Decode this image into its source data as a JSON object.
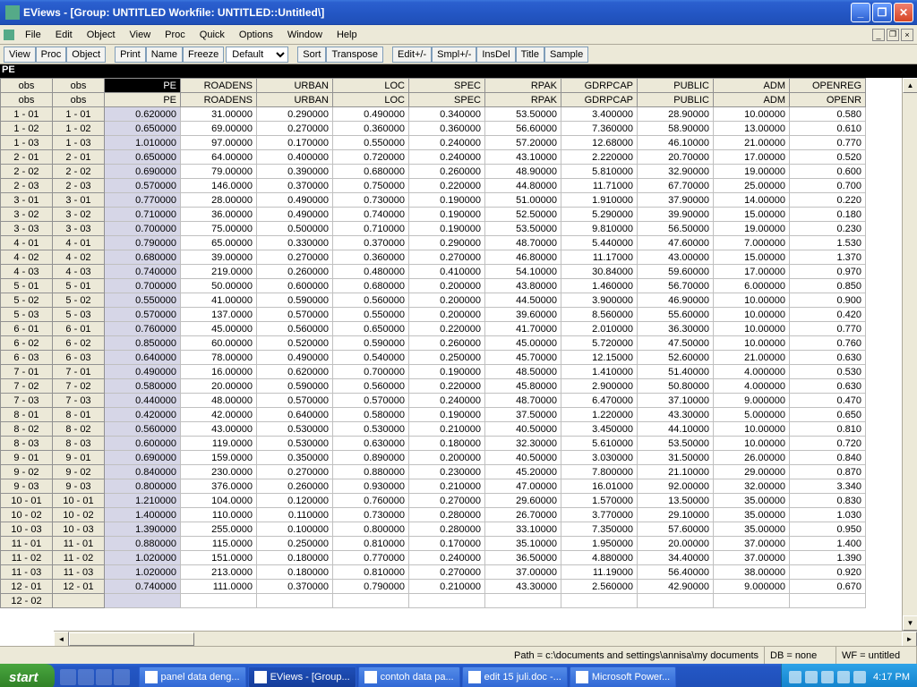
{
  "title": "EViews - [Group: UNTITLED   Workfile: UNTITLED::Untitled\\]",
  "menu": [
    "File",
    "Edit",
    "Object",
    "View",
    "Proc",
    "Quick",
    "Options",
    "Window",
    "Help"
  ],
  "toolbar1": [
    "View",
    "Proc",
    "Object"
  ],
  "toolbar2": [
    "Print",
    "Name",
    "Freeze"
  ],
  "toolbar_sel": "Default",
  "toolbar3": [
    "Sort",
    "Transpose"
  ],
  "toolbar4": [
    "Edit+/-",
    "Smpl+/-",
    "InsDel",
    "Title",
    "Sample"
  ],
  "dark_label": "PE",
  "cols": [
    "obs",
    "obs",
    "PE",
    "ROADENS",
    "URBAN",
    "LOC",
    "SPEC",
    "RPAK",
    "GDRPCAP",
    "PUBLIC",
    "ADM",
    "OPENREG"
  ],
  "cols2_last": "OPENR",
  "rows": [
    {
      "h": "1 - 01",
      "o": "1 - 01",
      "d": [
        "0.620000",
        "31.00000",
        "0.290000",
        "0.490000",
        "0.340000",
        "53.50000",
        "3.400000",
        "28.90000",
        "10.00000",
        "0.580"
      ]
    },
    {
      "h": "1 - 02",
      "o": "1 - 02",
      "d": [
        "0.650000",
        "69.00000",
        "0.270000",
        "0.360000",
        "0.360000",
        "56.60000",
        "7.360000",
        "58.90000",
        "13.00000",
        "0.610"
      ]
    },
    {
      "h": "1 - 03",
      "o": "1 - 03",
      "d": [
        "1.010000",
        "97.00000",
        "0.170000",
        "0.550000",
        "0.240000",
        "57.20000",
        "12.68000",
        "46.10000",
        "21.00000",
        "0.770"
      ]
    },
    {
      "h": "2 - 01",
      "o": "2 - 01",
      "d": [
        "0.650000",
        "64.00000",
        "0.400000",
        "0.720000",
        "0.240000",
        "43.10000",
        "2.220000",
        "20.70000",
        "17.00000",
        "0.520"
      ]
    },
    {
      "h": "2 - 02",
      "o": "2 - 02",
      "d": [
        "0.690000",
        "79.00000",
        "0.390000",
        "0.680000",
        "0.260000",
        "48.90000",
        "5.810000",
        "32.90000",
        "19.00000",
        "0.600"
      ]
    },
    {
      "h": "2 - 03",
      "o": "2 - 03",
      "d": [
        "0.570000",
        "146.0000",
        "0.370000",
        "0.750000",
        "0.220000",
        "44.80000",
        "11.71000",
        "67.70000",
        "25.00000",
        "0.700"
      ]
    },
    {
      "h": "3 - 01",
      "o": "3 - 01",
      "d": [
        "0.770000",
        "28.00000",
        "0.490000",
        "0.730000",
        "0.190000",
        "51.00000",
        "1.910000",
        "37.90000",
        "14.00000",
        "0.220"
      ]
    },
    {
      "h": "3 - 02",
      "o": "3 - 02",
      "d": [
        "0.710000",
        "36.00000",
        "0.490000",
        "0.740000",
        "0.190000",
        "52.50000",
        "5.290000",
        "39.90000",
        "15.00000",
        "0.180"
      ]
    },
    {
      "h": "3 - 03",
      "o": "3 - 03",
      "d": [
        "0.700000",
        "75.00000",
        "0.500000",
        "0.710000",
        "0.190000",
        "53.50000",
        "9.810000",
        "56.50000",
        "19.00000",
        "0.230"
      ]
    },
    {
      "h": "4 - 01",
      "o": "4 - 01",
      "d": [
        "0.790000",
        "65.00000",
        "0.330000",
        "0.370000",
        "0.290000",
        "48.70000",
        "5.440000",
        "47.60000",
        "7.000000",
        "1.530"
      ]
    },
    {
      "h": "4 - 02",
      "o": "4 - 02",
      "d": [
        "0.680000",
        "39.00000",
        "0.270000",
        "0.360000",
        "0.270000",
        "46.80000",
        "11.17000",
        "43.00000",
        "15.00000",
        "1.370"
      ]
    },
    {
      "h": "4 - 03",
      "o": "4 - 03",
      "d": [
        "0.740000",
        "219.0000",
        "0.260000",
        "0.480000",
        "0.410000",
        "54.10000",
        "30.84000",
        "59.60000",
        "17.00000",
        "0.970"
      ]
    },
    {
      "h": "5 - 01",
      "o": "5 - 01",
      "d": [
        "0.700000",
        "50.00000",
        "0.600000",
        "0.680000",
        "0.200000",
        "43.80000",
        "1.460000",
        "56.70000",
        "6.000000",
        "0.850"
      ]
    },
    {
      "h": "5 - 02",
      "o": "5 - 02",
      "d": [
        "0.550000",
        "41.00000",
        "0.590000",
        "0.560000",
        "0.200000",
        "44.50000",
        "3.900000",
        "46.90000",
        "10.00000",
        "0.900"
      ]
    },
    {
      "h": "5 - 03",
      "o": "5 - 03",
      "d": [
        "0.570000",
        "137.0000",
        "0.570000",
        "0.550000",
        "0.200000",
        "39.60000",
        "8.560000",
        "55.60000",
        "10.00000",
        "0.420"
      ]
    },
    {
      "h": "6 - 01",
      "o": "6 - 01",
      "d": [
        "0.760000",
        "45.00000",
        "0.560000",
        "0.650000",
        "0.220000",
        "41.70000",
        "2.010000",
        "36.30000",
        "10.00000",
        "0.770"
      ]
    },
    {
      "h": "6 - 02",
      "o": "6 - 02",
      "d": [
        "0.850000",
        "60.00000",
        "0.520000",
        "0.590000",
        "0.260000",
        "45.00000",
        "5.720000",
        "47.50000",
        "10.00000",
        "0.760"
      ]
    },
    {
      "h": "6 - 03",
      "o": "6 - 03",
      "d": [
        "0.640000",
        "78.00000",
        "0.490000",
        "0.540000",
        "0.250000",
        "45.70000",
        "12.15000",
        "52.60000",
        "21.00000",
        "0.630"
      ]
    },
    {
      "h": "7 - 01",
      "o": "7 - 01",
      "d": [
        "0.490000",
        "16.00000",
        "0.620000",
        "0.700000",
        "0.190000",
        "48.50000",
        "1.410000",
        "51.40000",
        "4.000000",
        "0.530"
      ]
    },
    {
      "h": "7 - 02",
      "o": "7 - 02",
      "d": [
        "0.580000",
        "20.00000",
        "0.590000",
        "0.560000",
        "0.220000",
        "45.80000",
        "2.900000",
        "50.80000",
        "4.000000",
        "0.630"
      ]
    },
    {
      "h": "7 - 03",
      "o": "7 - 03",
      "d": [
        "0.440000",
        "48.00000",
        "0.570000",
        "0.570000",
        "0.240000",
        "48.70000",
        "6.470000",
        "37.10000",
        "9.000000",
        "0.470"
      ]
    },
    {
      "h": "8 - 01",
      "o": "8 - 01",
      "d": [
        "0.420000",
        "42.00000",
        "0.640000",
        "0.580000",
        "0.190000",
        "37.50000",
        "1.220000",
        "43.30000",
        "5.000000",
        "0.650"
      ]
    },
    {
      "h": "8 - 02",
      "o": "8 - 02",
      "d": [
        "0.560000",
        "43.00000",
        "0.530000",
        "0.530000",
        "0.210000",
        "40.50000",
        "3.450000",
        "44.10000",
        "10.00000",
        "0.810"
      ]
    },
    {
      "h": "8 - 03",
      "o": "8 - 03",
      "d": [
        "0.600000",
        "119.0000",
        "0.530000",
        "0.630000",
        "0.180000",
        "32.30000",
        "5.610000",
        "53.50000",
        "10.00000",
        "0.720"
      ]
    },
    {
      "h": "9 - 01",
      "o": "9 - 01",
      "d": [
        "0.690000",
        "159.0000",
        "0.350000",
        "0.890000",
        "0.200000",
        "40.50000",
        "3.030000",
        "31.50000",
        "26.00000",
        "0.840"
      ]
    },
    {
      "h": "9 - 02",
      "o": "9 - 02",
      "d": [
        "0.840000",
        "230.0000",
        "0.270000",
        "0.880000",
        "0.230000",
        "45.20000",
        "7.800000",
        "21.10000",
        "29.00000",
        "0.870"
      ]
    },
    {
      "h": "9 - 03",
      "o": "9 - 03",
      "d": [
        "0.800000",
        "376.0000",
        "0.260000",
        "0.930000",
        "0.210000",
        "47.00000",
        "16.01000",
        "92.00000",
        "32.00000",
        "3.340"
      ]
    },
    {
      "h": "10 - 01",
      "o": "10 - 01",
      "d": [
        "1.210000",
        "104.0000",
        "0.120000",
        "0.760000",
        "0.270000",
        "29.60000",
        "1.570000",
        "13.50000",
        "35.00000",
        "0.830"
      ]
    },
    {
      "h": "10 - 02",
      "o": "10 - 02",
      "d": [
        "1.400000",
        "110.0000",
        "0.110000",
        "0.730000",
        "0.280000",
        "26.70000",
        "3.770000",
        "29.10000",
        "35.00000",
        "1.030"
      ]
    },
    {
      "h": "10 - 03",
      "o": "10 - 03",
      "d": [
        "1.390000",
        "255.0000",
        "0.100000",
        "0.800000",
        "0.280000",
        "33.10000",
        "7.350000",
        "57.60000",
        "35.00000",
        "0.950"
      ]
    },
    {
      "h": "11 - 01",
      "o": "11 - 01",
      "d": [
        "0.880000",
        "115.0000",
        "0.250000",
        "0.810000",
        "0.170000",
        "35.10000",
        "1.950000",
        "20.00000",
        "37.00000",
        "1.400"
      ]
    },
    {
      "h": "11 - 02",
      "o": "11 - 02",
      "d": [
        "1.020000",
        "151.0000",
        "0.180000",
        "0.770000",
        "0.240000",
        "36.50000",
        "4.880000",
        "34.40000",
        "37.00000",
        "1.390"
      ]
    },
    {
      "h": "11 - 03",
      "o": "11 - 03",
      "d": [
        "1.020000",
        "213.0000",
        "0.180000",
        "0.810000",
        "0.270000",
        "37.00000",
        "11.19000",
        "56.40000",
        "38.00000",
        "0.920"
      ]
    },
    {
      "h": "12 - 01",
      "o": "12 - 01",
      "d": [
        "0.740000",
        "111.0000",
        "0.370000",
        "0.790000",
        "0.210000",
        "43.30000",
        "2.560000",
        "42.90000",
        "9.000000",
        "0.670"
      ]
    },
    {
      "h": "12 - 02",
      "o": "",
      "d": [
        "",
        "",
        "",
        "",
        "",
        "",
        "",
        "",
        "",
        ""
      ]
    }
  ],
  "status": {
    "path": "Path = c:\\documents and settings\\annisa\\my documents",
    "db": "DB = none",
    "wf": "WF = untitled"
  },
  "start": "start",
  "tasks": [
    {
      "label": "panel data deng...",
      "active": false
    },
    {
      "label": "EViews - [Group...",
      "active": true
    },
    {
      "label": "contoh data pa...",
      "active": false
    },
    {
      "label": "edit 15 juli.doc -...",
      "active": false
    },
    {
      "label": "Microsoft Power...",
      "active": false
    }
  ],
  "clock": "4:17 PM"
}
